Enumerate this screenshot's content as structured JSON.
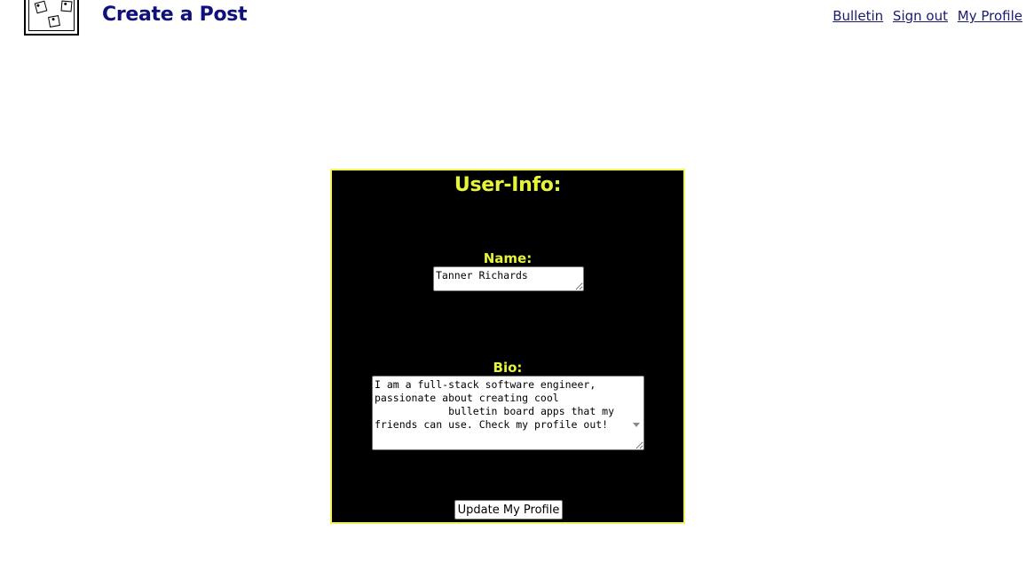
{
  "header": {
    "title": "Create a Post",
    "nav": {
      "bulletin": "Bulletin",
      "sign_out": "Sign out",
      "my_profile": "My Profile"
    }
  },
  "card": {
    "title": "User-Info:",
    "name_label": "Name:",
    "name_value": "Tanner Richards",
    "bio_label": "Bio:",
    "bio_value": "I am a full-stack software engineer, passionate about creating cool\n            bulletin board apps that my friends can use. Check my profile out!",
    "update_button": "Update My Profile"
  },
  "colors": {
    "title_navy": "#10107a",
    "accent_yellow": "#e6f53a",
    "card_border": "#f2f25a",
    "card_bg": "#000000"
  }
}
